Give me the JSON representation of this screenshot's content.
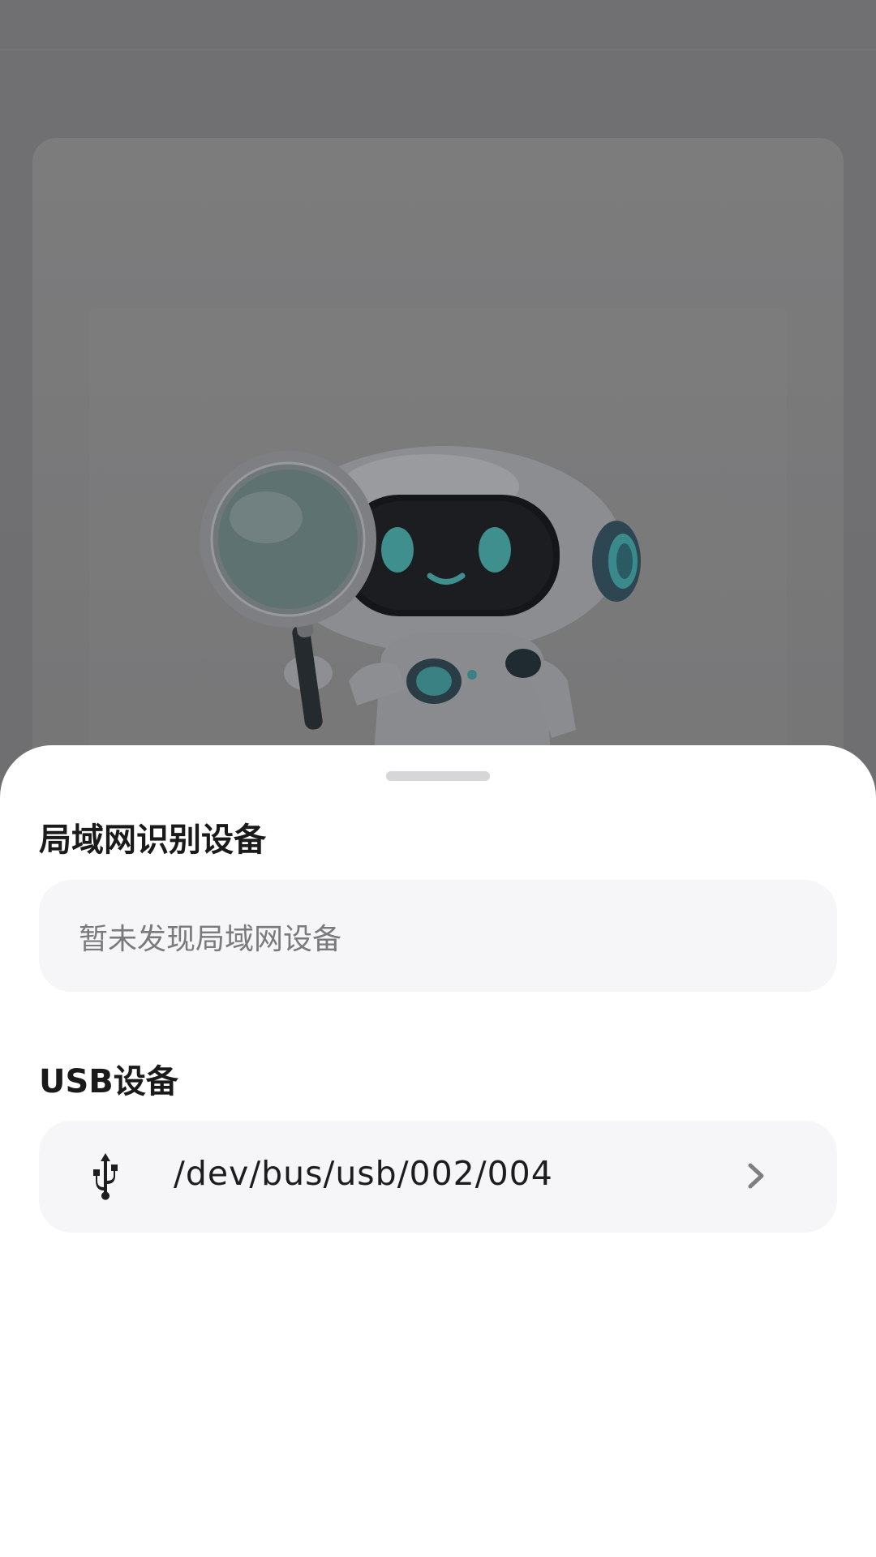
{
  "lan_section": {
    "title": "局域网识别设备",
    "empty_text": "暂未发现局域网设备"
  },
  "usb_section": {
    "title": "USB设备",
    "devices": [
      {
        "path": "/dev/bus/usb/002/004",
        "icon": "usb-icon",
        "action_icon": "chevron-right-icon"
      }
    ]
  },
  "background": {
    "illustration": "robot-with-magnifying-glass"
  },
  "colors": {
    "overlay": "#6f6f71",
    "sheet": "#ffffff",
    "panel": "#f6f6f8",
    "handle": "#d6d6d8",
    "title": "#1a1a1a",
    "muted_text": "#7a7a7c"
  }
}
